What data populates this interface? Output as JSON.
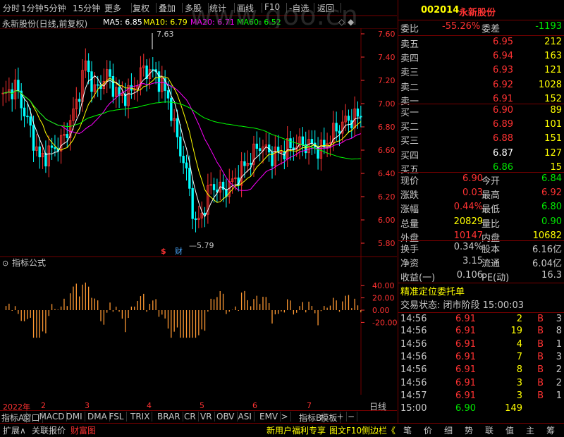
{
  "topbar": {
    "items": [
      "分时",
      "1分钟",
      "5分钟",
      "15分钟",
      "更多",
      "复权",
      "叠加",
      "多股",
      "统计",
      "画线",
      "F10",
      "-自选",
      "返回"
    ],
    "watermark": "www.goo.cn"
  },
  "stock": {
    "code": "002014",
    "name": "永新股份",
    "title": "永新股份(日线,前复权)",
    "ma5": "MA5: 6.85",
    "ma10": "MA10: 6.79",
    "ma20": "MA20: 6.71",
    "ma60": "MA60: 6.52",
    "high_note": "7.63",
    "low_note": "5.79",
    "marker1": "$",
    "marker2": "财"
  },
  "colors": {
    "ma5": "#ffffff",
    "ma10": "#ffff00",
    "ma20": "#ff00ff",
    "ma60": "#00ff00",
    "up": "#ff3232",
    "down": "#00ffff",
    "grid": "#700000",
    "indicator": "#ff9933"
  },
  "price_axis": [
    "7.60",
    "7.40",
    "7.20",
    "7.00",
    "6.80",
    "6.60",
    "6.40",
    "6.20",
    "6.00",
    "5.80"
  ],
  "ind_axis": [
    "40.00",
    "20.00",
    "0.00",
    "-20.00"
  ],
  "indicator": {
    "title": "指标公式"
  },
  "date_labels": [
    "2022年",
    "2",
    "3",
    "4",
    "5",
    "6",
    "7"
  ],
  "bottom_tabs": [
    "指标A",
    "窗口",
    "MACD",
    "DMI",
    "DMA",
    "FSL",
    "TRIX",
    "BRAR",
    "CR",
    "VR",
    "OBV",
    "ASI",
    "EMV",
    ">",
    "指标B",
    "模板",
    "+",
    "−"
  ],
  "right_top_label": "日线",
  "bottom_bar": {
    "left": [
      "扩展∧",
      "关联报价",
      "财富图"
    ],
    "mid": [
      "新用户福利专享",
      "图文F10",
      "侧边栏《"
    ],
    "right": [
      "笔",
      "价",
      "细",
      "势",
      "联",
      "值",
      "主",
      "筹"
    ]
  },
  "quote": {
    "weibi_label": "委比",
    "weibi": "-55.26%",
    "weicha_label": "委差",
    "weicha": "-1193",
    "asks": [
      {
        "l": "卖五",
        "p": "6.95",
        "v": "212"
      },
      {
        "l": "卖四",
        "p": "6.94",
        "v": "163"
      },
      {
        "l": "卖三",
        "p": "6.93",
        "v": "121"
      },
      {
        "l": "卖二",
        "p": "6.92",
        "v": "1028"
      },
      {
        "l": "卖一",
        "p": "6.91",
        "v": "152"
      }
    ],
    "bids": [
      {
        "l": "买一",
        "p": "6.90",
        "v": "89"
      },
      {
        "l": "买二",
        "p": "6.89",
        "v": "101"
      },
      {
        "l": "买三",
        "p": "6.88",
        "v": "151"
      },
      {
        "l": "买四",
        "p": "6.87",
        "v": "127"
      },
      {
        "l": "买五",
        "p": "6.86",
        "v": "15"
      }
    ],
    "stats": [
      [
        "现价",
        "6.90",
        "今开",
        "6.84"
      ],
      [
        "涨跌",
        "0.03",
        "最高",
        "6.92"
      ],
      [
        "涨幅",
        "0.44%",
        "最低",
        "6.80"
      ],
      [
        "总量",
        "20829",
        "量比",
        "0.90"
      ],
      [
        "外盘",
        "10147",
        "内盘",
        "10682"
      ]
    ],
    "stats2": [
      [
        "换手",
        "0.34%",
        "股本",
        "6.16亿"
      ],
      [
        "净资",
        "3.15",
        "流通",
        "6.04亿"
      ],
      [
        "收益(一)",
        "0.106",
        "PE(动)",
        "16.3"
      ]
    ],
    "jz_title": "精准定位委托单",
    "trade_state": "交易状态: 闭市阶段 15:00:03",
    "ticks": [
      [
        "14:56",
        "6.91",
        "2",
        "B",
        "3"
      ],
      [
        "14:56",
        "6.91",
        "19",
        "B",
        "8"
      ],
      [
        "14:56",
        "6.91",
        "4",
        "B",
        "1"
      ],
      [
        "14:56",
        "6.91",
        "7",
        "B",
        "3"
      ],
      [
        "14:56",
        "6.91",
        "8",
        "B",
        "2"
      ],
      [
        "14:56",
        "6.91",
        "3",
        "B",
        "2"
      ],
      [
        "14:57",
        "6.91",
        "3",
        "B",
        "1"
      ],
      [
        "15:00",
        "6.90",
        "149",
        "",
        ""
      ]
    ]
  }
}
